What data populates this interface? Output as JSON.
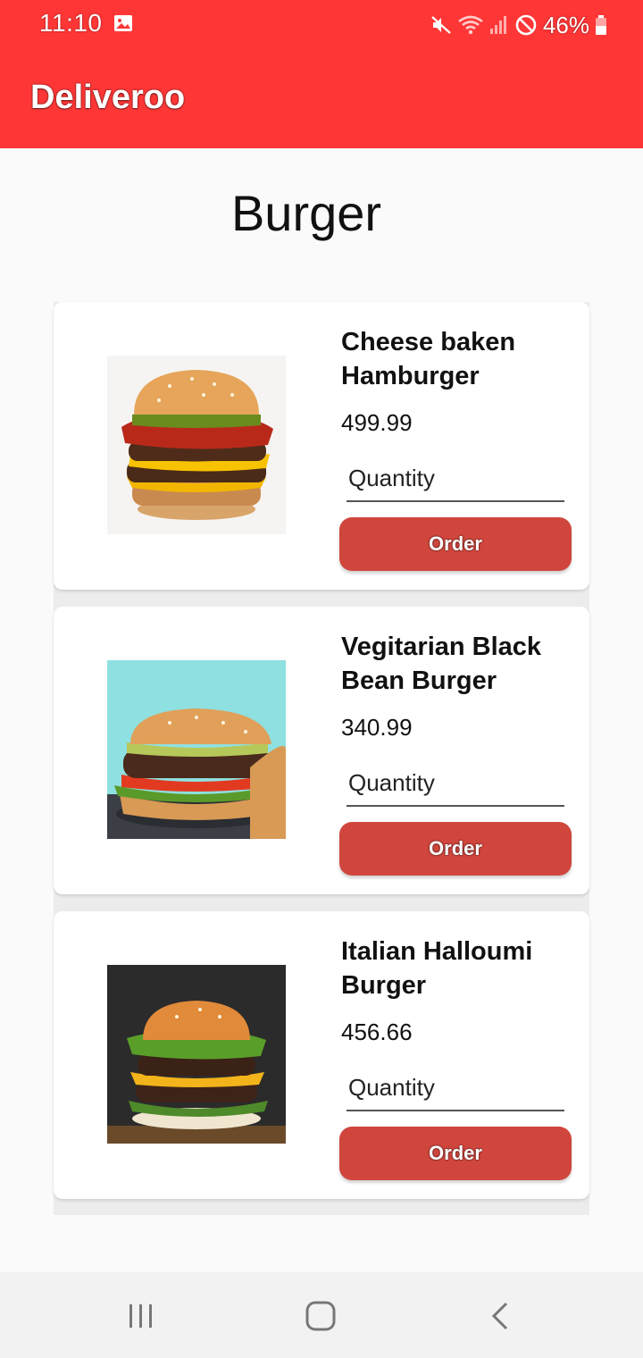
{
  "status_bar": {
    "time": "11:10",
    "battery": "46%",
    "icons": [
      "gallery-icon",
      "mute-icon",
      "wifi-icon",
      "signal-icon",
      "do-not-disturb-icon",
      "battery-icon"
    ]
  },
  "app_bar": {
    "title": "Deliveroo",
    "color": "#ff3636"
  },
  "page": {
    "heading": "Burger"
  },
  "items": [
    {
      "name": "Cheese baken Hamburger",
      "price": "499.99",
      "quantity_placeholder": "Quantity",
      "order_label": "Order"
    },
    {
      "name": "Vegitarian Black Bean Burger",
      "price": "340.99",
      "quantity_placeholder": "Quantity",
      "order_label": "Order"
    },
    {
      "name": "Italian Halloumi Burger",
      "price": "456.66",
      "quantity_placeholder": "Quantity",
      "order_label": "Order"
    }
  ],
  "colors": {
    "order_button": "#d0463d",
    "background": "#fafafa"
  },
  "nav_bar": {
    "icons": [
      "recent-apps-icon",
      "home-icon",
      "back-icon"
    ]
  }
}
